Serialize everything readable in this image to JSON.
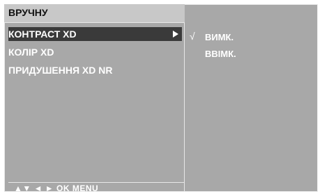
{
  "menu": {
    "title": "ВРУЧНУ",
    "items": [
      {
        "label": "КОНТРАСТ XD",
        "selected": true
      },
      {
        "label": "КОЛІР XD",
        "selected": false
      },
      {
        "label": "ПРИДУШЕННЯ XD NR",
        "selected": false
      }
    ],
    "hint": "▲▼ ◄ ► OK MENU"
  },
  "submenu": {
    "check_mark": "√",
    "options": [
      {
        "label": "ВИМК.",
        "checked": true
      },
      {
        "label": "ВВІМК.",
        "checked": false
      }
    ]
  },
  "colors": {
    "panel": "#a8a8a8",
    "title_bar": "#c8c8c8",
    "highlight": "#3a3a3a"
  }
}
